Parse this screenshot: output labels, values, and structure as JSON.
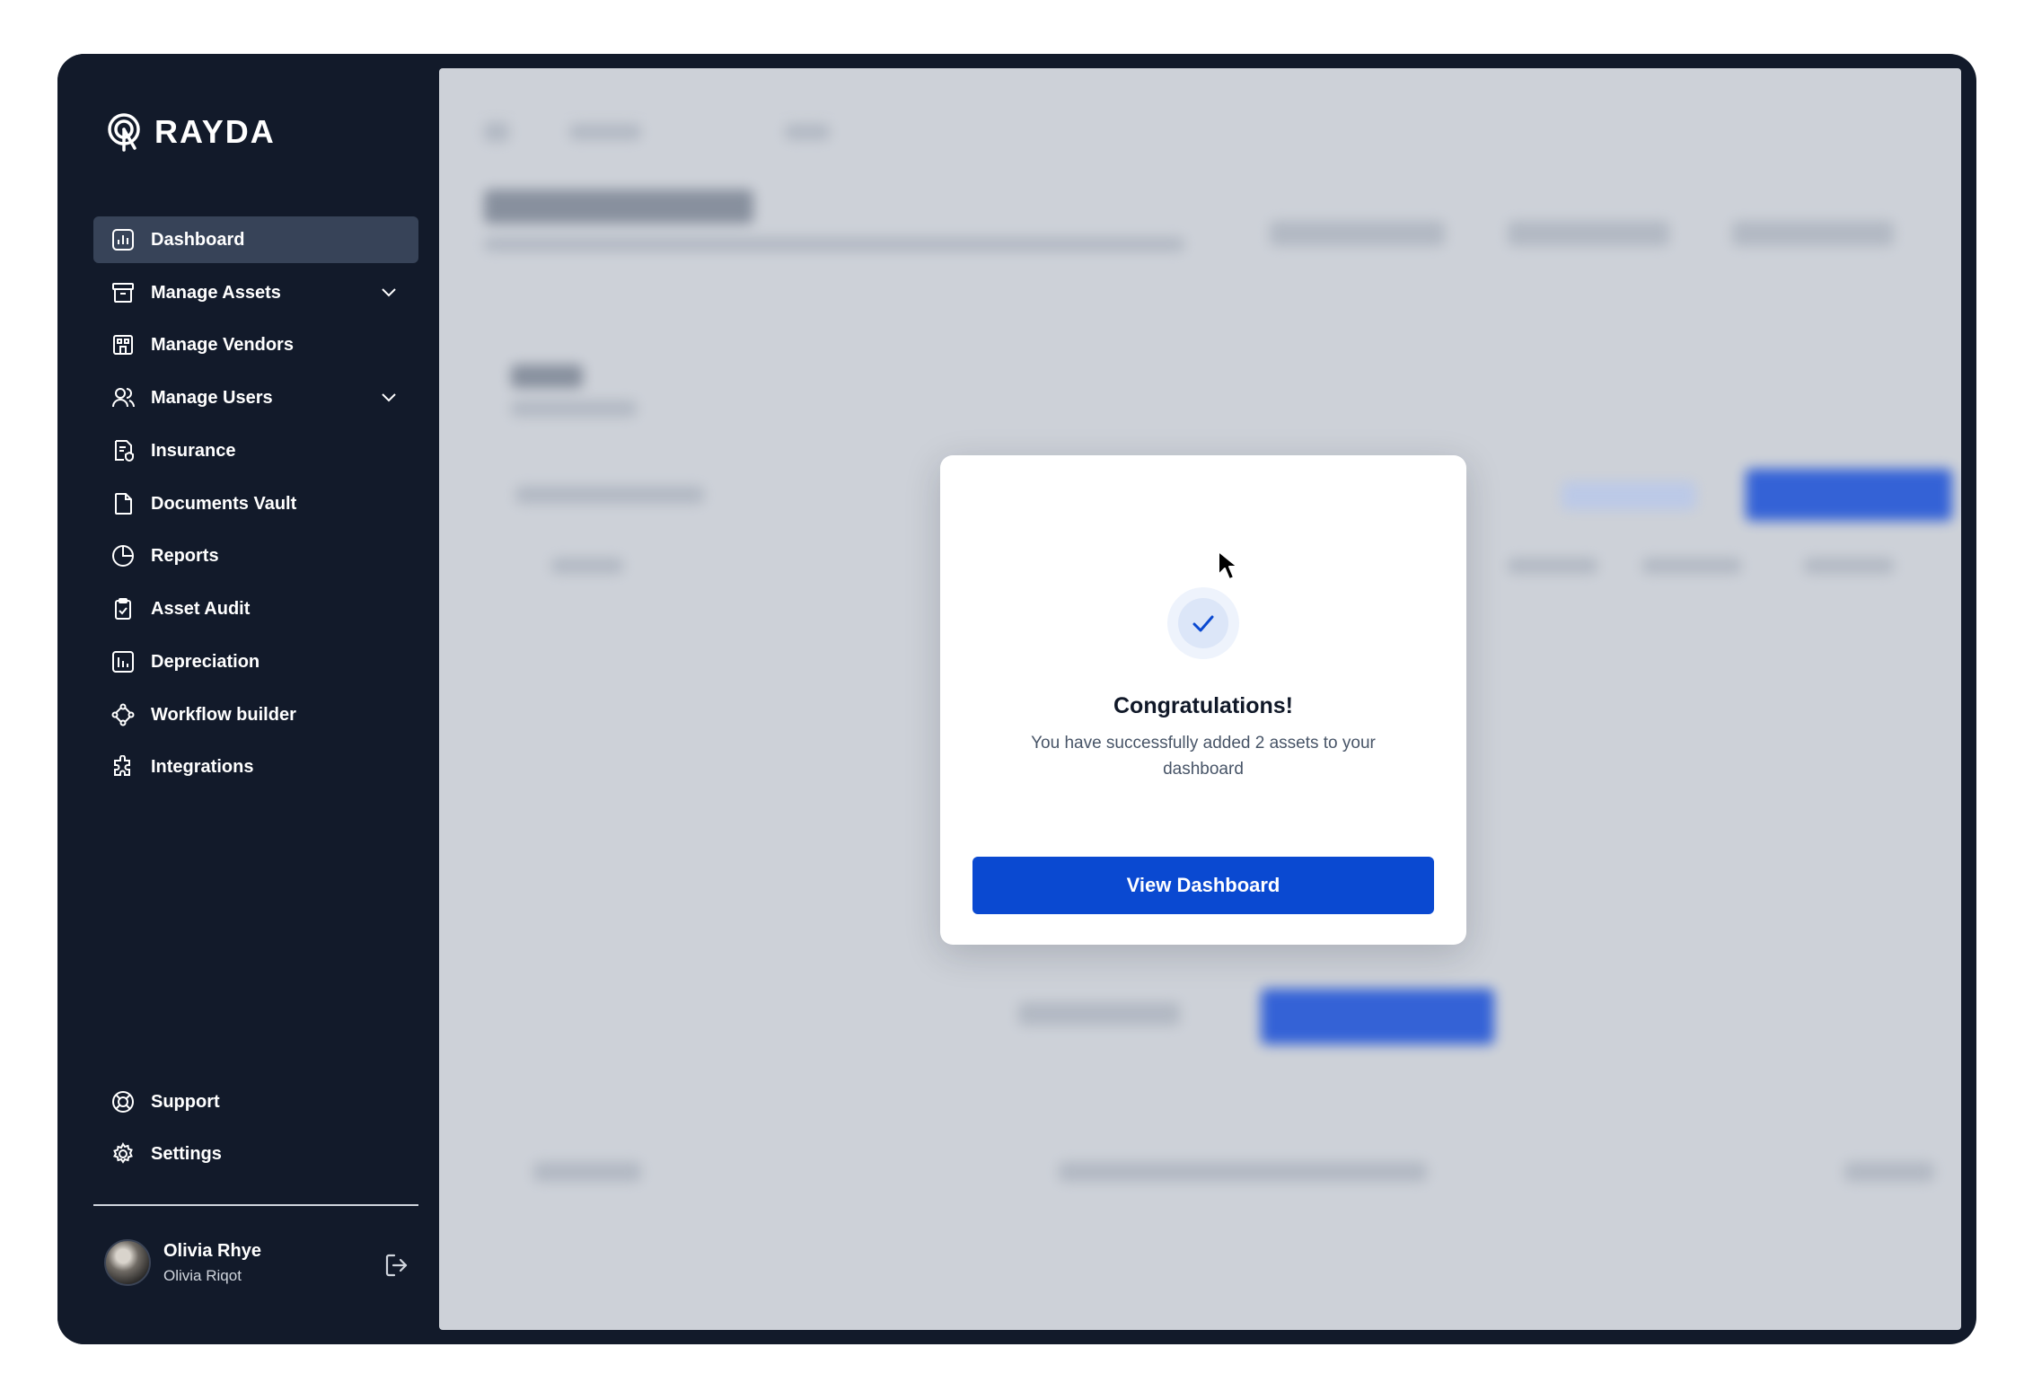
{
  "brand": {
    "name": "RAYDA",
    "logo_icon": "location-pin-logo-icon"
  },
  "sidebar": {
    "items": [
      {
        "label": "Dashboard",
        "icon": "bar-chart-square-icon",
        "active": true,
        "expandable": false
      },
      {
        "label": "Manage Assets",
        "icon": "archive-box-icon",
        "active": false,
        "expandable": true
      },
      {
        "label": "Manage Vendors",
        "icon": "building-icon",
        "active": false,
        "expandable": false
      },
      {
        "label": "Manage Users",
        "icon": "users-icon",
        "active": false,
        "expandable": true
      },
      {
        "label": "Insurance",
        "icon": "file-shield-icon",
        "active": false,
        "expandable": false
      },
      {
        "label": "Documents Vault",
        "icon": "file-icon",
        "active": false,
        "expandable": false
      },
      {
        "label": "Reports",
        "icon": "pie-chart-icon",
        "active": false,
        "expandable": false
      },
      {
        "label": "Asset Audit",
        "icon": "clipboard-check-icon",
        "active": false,
        "expandable": false
      },
      {
        "label": "Depreciation",
        "icon": "bar-chart-icon",
        "active": false,
        "expandable": false
      },
      {
        "label": "Workflow builder",
        "icon": "dataflow-icon",
        "active": false,
        "expandable": false
      },
      {
        "label": "Integrations",
        "icon": "puzzle-piece-icon",
        "active": false,
        "expandable": false
      }
    ],
    "footer_items": [
      {
        "label": "Support",
        "icon": "life-buoy-icon"
      },
      {
        "label": "Settings",
        "icon": "gear-icon"
      }
    ],
    "user": {
      "name": "Olivia Rhye",
      "subtitle": "Olivia Riqot",
      "logout_icon": "logout-icon"
    }
  },
  "modal": {
    "title": "Congratulations!",
    "message": "You have successfully added 2 assets to your dashboard",
    "button_label": "View Dashboard",
    "icon": "check-icon"
  },
  "colors": {
    "sidebar_bg": "#121a2a",
    "active_item_bg": "#374358",
    "primary": "#0a49d1",
    "overlay": "#cdd1d8"
  }
}
